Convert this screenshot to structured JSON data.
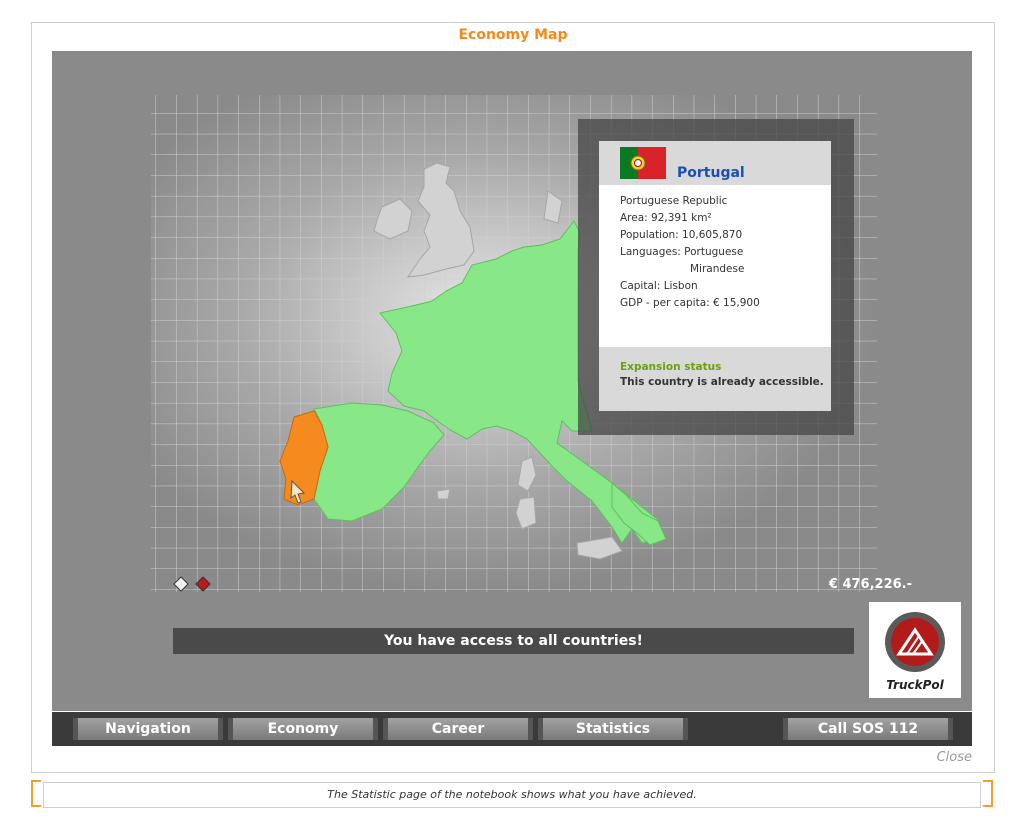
{
  "window": {
    "title": "Economy Map",
    "close_label": "Close"
  },
  "info_panel": {
    "country_name": "Portugal",
    "lines": {
      "official_name": "Portuguese Republic",
      "area": "Area: 92,391 km²",
      "population": "Population:  10,605,870",
      "languages": "Languages: Portuguese",
      "languages_2": "Mirandese",
      "capital": "Capital: Lisbon",
      "gdp": "GDP - per capita: € 15,900"
    },
    "expansion_title": "Expansion status",
    "expansion_text": "This country is already accessible."
  },
  "money": "€ 476,226.-",
  "access_message": "You have access to all countries!",
  "logo_text": "TruckPol",
  "nav": {
    "navigation": "Navigation",
    "economy": "Economy",
    "career": "Career",
    "statistics": "Statistics",
    "sos": "Call SOS 112"
  },
  "status_message": "The Statistic page of the notebook shows what you have achieved.",
  "colors": {
    "accent": "#f08a1c",
    "accessible_country": "#88e888",
    "selected_country": "#f58a1e",
    "country_name": "#1a4fb5",
    "expansion_title": "#6aa10f"
  }
}
